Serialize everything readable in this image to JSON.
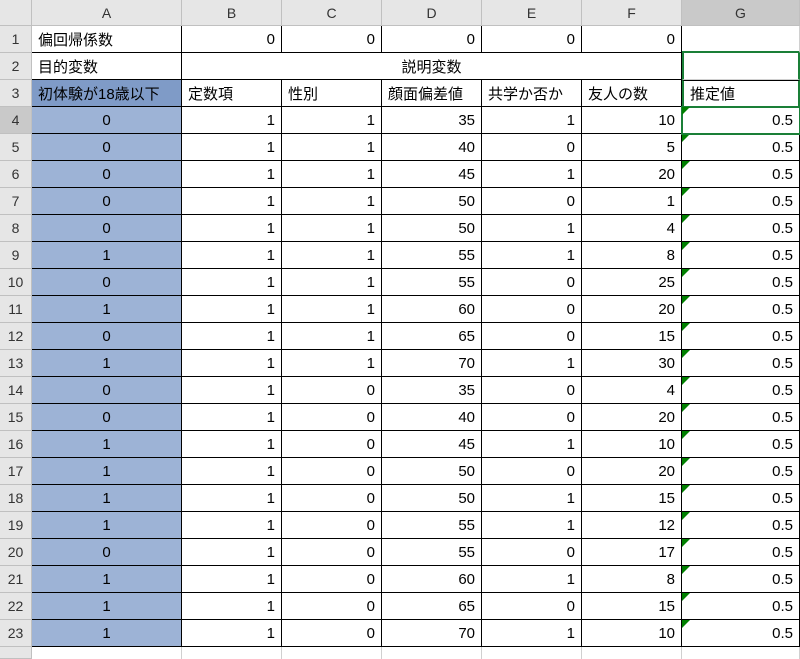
{
  "columns": [
    "A",
    "B",
    "C",
    "D",
    "E",
    "F",
    "G"
  ],
  "row1_label": "偏回帰係数",
  "row1_values": [
    "0",
    "0",
    "0",
    "0",
    "0"
  ],
  "row2_label": "目的変数",
  "row2_merged": "説明変数",
  "row3": {
    "A": "初体験が18歳以下",
    "B": "定数項",
    "C": "性別",
    "D": "顔面偏差値",
    "E": "共学か否か",
    "F": "友人の数",
    "G": "推定値"
  },
  "data_rows": [
    {
      "r": 4,
      "A": "0",
      "B": "1",
      "C": "1",
      "D": "35",
      "E": "1",
      "F": "10",
      "G": "0.5"
    },
    {
      "r": 5,
      "A": "0",
      "B": "1",
      "C": "1",
      "D": "40",
      "E": "0",
      "F": "5",
      "G": "0.5"
    },
    {
      "r": 6,
      "A": "0",
      "B": "1",
      "C": "1",
      "D": "45",
      "E": "1",
      "F": "20",
      "G": "0.5"
    },
    {
      "r": 7,
      "A": "0",
      "B": "1",
      "C": "1",
      "D": "50",
      "E": "0",
      "F": "1",
      "G": "0.5"
    },
    {
      "r": 8,
      "A": "0",
      "B": "1",
      "C": "1",
      "D": "50",
      "E": "1",
      "F": "4",
      "G": "0.5"
    },
    {
      "r": 9,
      "A": "1",
      "B": "1",
      "C": "1",
      "D": "55",
      "E": "1",
      "F": "8",
      "G": "0.5"
    },
    {
      "r": 10,
      "A": "0",
      "B": "1",
      "C": "1",
      "D": "55",
      "E": "0",
      "F": "25",
      "G": "0.5"
    },
    {
      "r": 11,
      "A": "1",
      "B": "1",
      "C": "1",
      "D": "60",
      "E": "0",
      "F": "20",
      "G": "0.5"
    },
    {
      "r": 12,
      "A": "0",
      "B": "1",
      "C": "1",
      "D": "65",
      "E": "0",
      "F": "15",
      "G": "0.5"
    },
    {
      "r": 13,
      "A": "1",
      "B": "1",
      "C": "1",
      "D": "70",
      "E": "1",
      "F": "30",
      "G": "0.5"
    },
    {
      "r": 14,
      "A": "0",
      "B": "1",
      "C": "0",
      "D": "35",
      "E": "0",
      "F": "4",
      "G": "0.5"
    },
    {
      "r": 15,
      "A": "0",
      "B": "1",
      "C": "0",
      "D": "40",
      "E": "0",
      "F": "20",
      "G": "0.5"
    },
    {
      "r": 16,
      "A": "1",
      "B": "1",
      "C": "0",
      "D": "45",
      "E": "1",
      "F": "10",
      "G": "0.5"
    },
    {
      "r": 17,
      "A": "1",
      "B": "1",
      "C": "0",
      "D": "50",
      "E": "0",
      "F": "20",
      "G": "0.5"
    },
    {
      "r": 18,
      "A": "1",
      "B": "1",
      "C": "0",
      "D": "50",
      "E": "1",
      "F": "15",
      "G": "0.5"
    },
    {
      "r": 19,
      "A": "1",
      "B": "1",
      "C": "0",
      "D": "55",
      "E": "1",
      "F": "12",
      "G": "0.5"
    },
    {
      "r": 20,
      "A": "0",
      "B": "1",
      "C": "0",
      "D": "55",
      "E": "0",
      "F": "17",
      "G": "0.5"
    },
    {
      "r": 21,
      "A": "1",
      "B": "1",
      "C": "0",
      "D": "60",
      "E": "1",
      "F": "8",
      "G": "0.5"
    },
    {
      "r": 22,
      "A": "1",
      "B": "1",
      "C": "0",
      "D": "65",
      "E": "0",
      "F": "15",
      "G": "0.5"
    },
    {
      "r": 23,
      "A": "1",
      "B": "1",
      "C": "0",
      "D": "70",
      "E": "1",
      "F": "10",
      "G": "0.5"
    }
  ],
  "active_cell": "G4",
  "selected_column": "G"
}
